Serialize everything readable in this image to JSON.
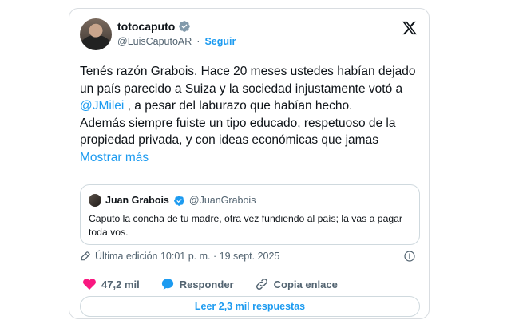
{
  "author": {
    "display_name": "totocaputo",
    "handle": "@LuisCaputoAR",
    "separator": "·",
    "follow_label": "Seguir"
  },
  "tweet": {
    "text_part1": "Tenés razón Grabois. Hace 20 meses ustedes habían dejado un país parecido a Suiza y la sociedad injustamente votó a ",
    "mention": "@JMilei",
    "text_part2": " , a pesar del laburazo que habían hecho.",
    "text_part3": "Además siempre fuiste un tipo educado, respetuoso de la propiedad privada, y con ideas económicas que jamas ",
    "show_more": "Mostrar más"
  },
  "quote": {
    "display_name": "Juan Grabois",
    "handle": "@JuanGrabois",
    "text": "Caputo la concha de tu madre, otra vez fundiendo al país; la vas a pagar toda vos."
  },
  "meta": {
    "edited": "Última edición 10:01 p. m. · 19 sept. 2025"
  },
  "actions": {
    "likes": "47,2 mil",
    "reply": "Responder",
    "copy_link": "Copia enlace"
  },
  "replies_button": "Leer 2,3 mil respuestas",
  "colors": {
    "accent": "#1d9bf0",
    "like": "#f91880",
    "verified_gray": "#829aab",
    "text": "#0f1419",
    "secondary": "#536471"
  },
  "icons": [
    "verified-badge-icon",
    "x-logo-icon",
    "pencil-edit-icon",
    "info-icon",
    "heart-icon",
    "reply-bubble-icon",
    "link-icon"
  ]
}
